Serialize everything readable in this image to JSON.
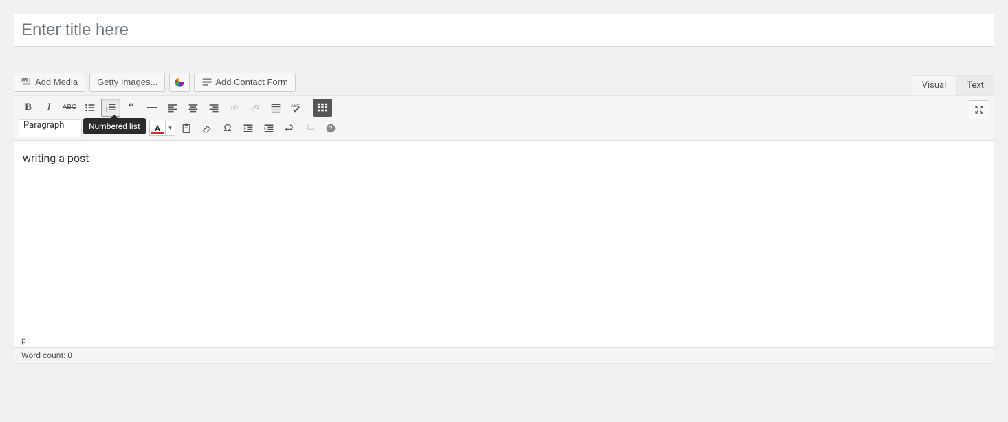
{
  "title": {
    "placeholder": "Enter title here",
    "value": ""
  },
  "media_buttons": {
    "add_media": "Add Media",
    "getty": "Getty Images...",
    "contact_form": "Add Contact Form"
  },
  "tabs": {
    "visual": "Visual",
    "text": "Text",
    "active": "visual"
  },
  "toolbar": {
    "format_selected": "Paragraph",
    "tooltip": "Numbered list"
  },
  "editor": {
    "content": "writing a post",
    "path": "p"
  },
  "status": {
    "word_count_label": "Word count: ",
    "word_count_value": "0"
  }
}
